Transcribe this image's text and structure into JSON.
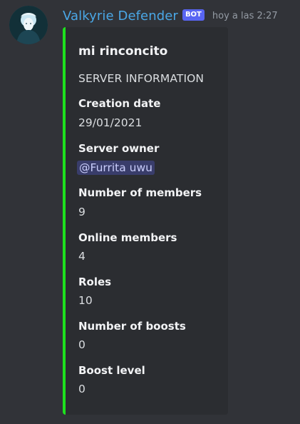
{
  "message": {
    "author": "Valkyrie Defender",
    "bot_tag": "BOT",
    "timestamp": "hoy a las 2:27",
    "accent_color": "#1ee01e",
    "username_color": "#4aa7e6"
  },
  "embed": {
    "title": "mi rinconcito",
    "description": "SERVER INFORMATION",
    "fields": [
      {
        "name": "Creation date",
        "value": "29/01/2021"
      },
      {
        "name": "Server owner",
        "value": "@Furrita uwu",
        "mention": true
      },
      {
        "name": "Number of members",
        "value": "9"
      },
      {
        "name": "Online members",
        "value": "4"
      },
      {
        "name": "Roles",
        "value": "10"
      },
      {
        "name": "Number of boosts",
        "value": "0"
      },
      {
        "name": "Boost level",
        "value": "0"
      }
    ]
  }
}
